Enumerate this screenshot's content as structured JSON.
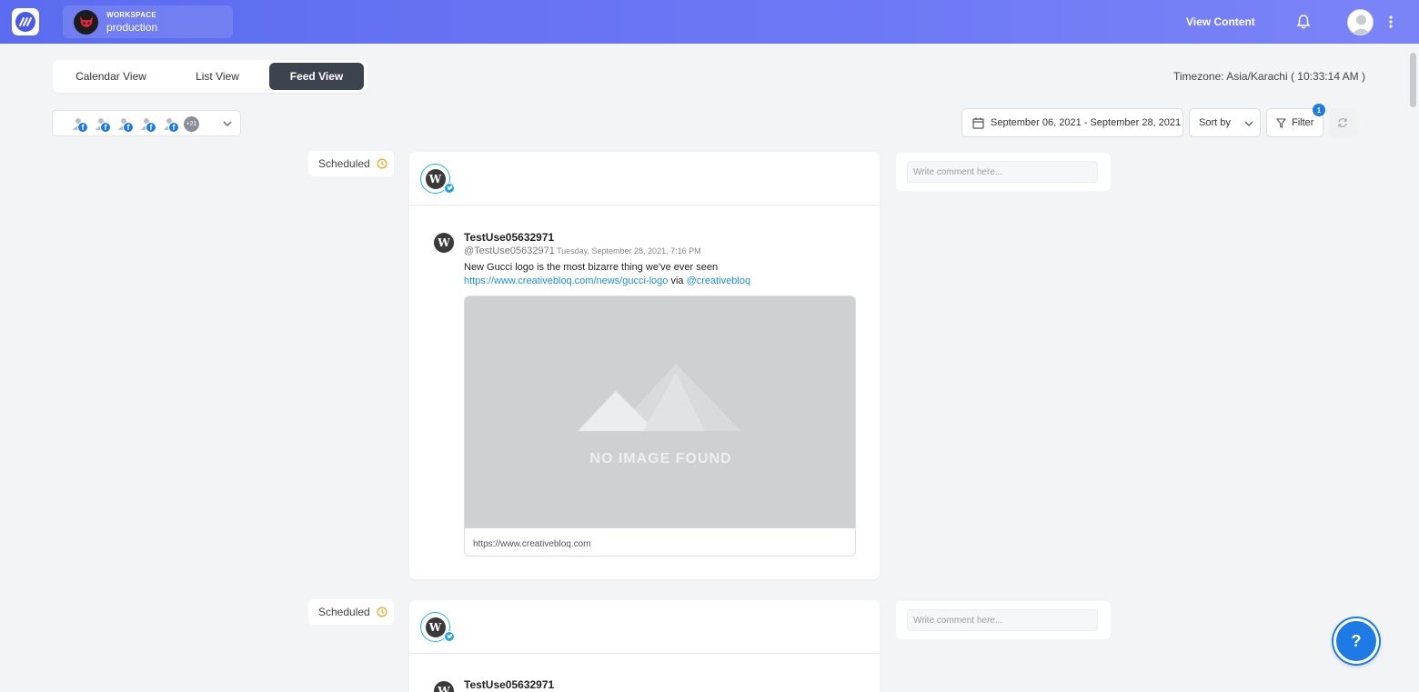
{
  "topbar": {
    "workspace_label": "WORKSPACE",
    "workspace_name": "production",
    "view_content": "View Content"
  },
  "tabs": [
    {
      "label": "Calendar View",
      "active": false
    },
    {
      "label": "List View",
      "active": false
    },
    {
      "label": "Feed View",
      "active": true
    }
  ],
  "timezone": "Timezone: Asia/Karachi ( 10:33:14 AM )",
  "accounts": {
    "visible_count": 5,
    "platform": "facebook",
    "more_label": "+21"
  },
  "filters": {
    "date_range": "September 06, 2021 - September 28, 2021",
    "sort_label": "Sort by",
    "filter_label": "Filter",
    "filter_count": "1"
  },
  "posts": [
    {
      "status": "Scheduled",
      "name": "TestUse05632971",
      "handle": "@TestUse05632971",
      "date": "Tuesday, September 28, 2021, 7:16 PM",
      "text": "New Gucci logo is the most bizarre thing we've ever seen",
      "link": "https://www.creativebloq.com/news/gucci-logo",
      "via": "via",
      "mention": "@creativebloq",
      "no_image": "NO IMAGE FOUND",
      "card_url": "https://www.creativebloq.com",
      "comment_placeholder": "Write comment here..."
    },
    {
      "status": "Scheduled",
      "name": "TestUse05632971",
      "comment_placeholder": "Write comment here..."
    }
  ],
  "help_label": "?",
  "colors": {
    "topbar_start": "#5b6cf0",
    "active_tab": "#3d4450",
    "twitter": "#1da1f2",
    "facebook": "#1877f2",
    "link": "#1e90d6",
    "help": "#1e7be6",
    "scheduled_icon": "#f0a830"
  }
}
